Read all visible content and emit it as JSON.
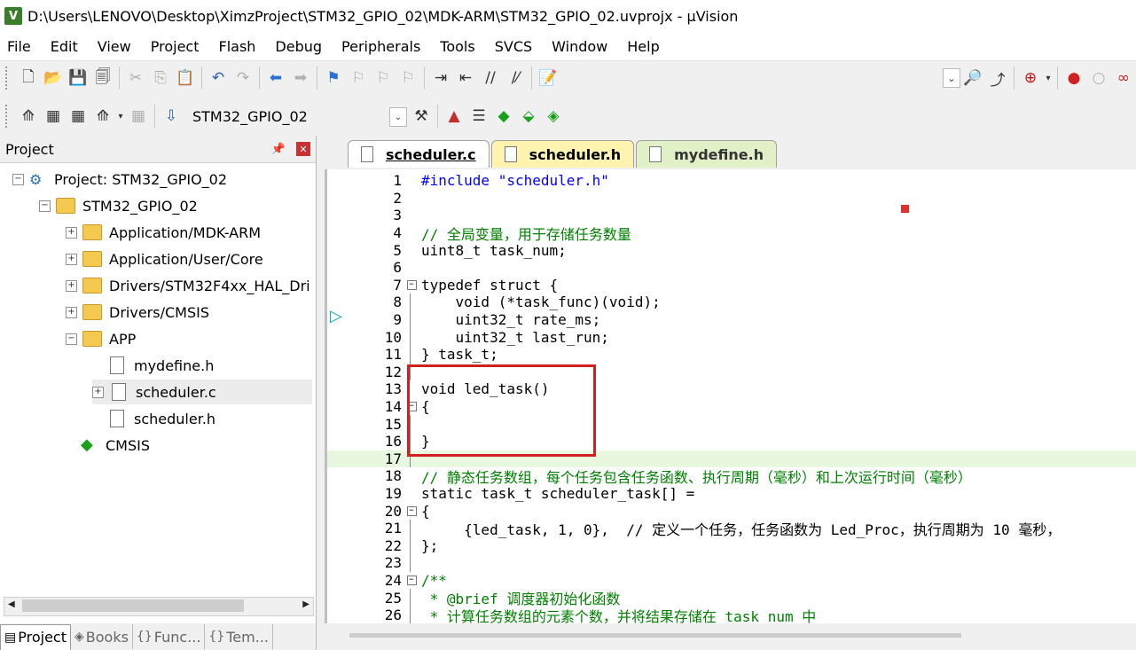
{
  "window": {
    "title": "D:\\Users\\LENOVO\\Desktop\\XimzProject\\STM32_GPIO_02\\MDK-ARM\\STM32_GPIO_02.uvprojx - µVision",
    "app_icon": "V"
  },
  "menu": [
    "File",
    "Edit",
    "View",
    "Project",
    "Flash",
    "Debug",
    "Peripherals",
    "Tools",
    "SVCS",
    "Window",
    "Help"
  ],
  "toolbar2": {
    "target": "STM32_GPIO_02"
  },
  "project_panel": {
    "title": "Project",
    "tree": [
      {
        "label": "Project: STM32_GPIO_02"
      },
      {
        "label": "STM32_GPIO_02"
      },
      {
        "label": "Application/MDK-ARM"
      },
      {
        "label": "Application/User/Core"
      },
      {
        "label": "Drivers/STM32F4xx_HAL_Dri"
      },
      {
        "label": "Drivers/CMSIS"
      },
      {
        "label": "APP"
      },
      {
        "label": "mydefine.h"
      },
      {
        "label": "scheduler.c"
      },
      {
        "label": "scheduler.h"
      },
      {
        "label": "CMSIS"
      }
    ],
    "bottom_tabs": [
      {
        "label": "Project"
      },
      {
        "label": "Books"
      },
      {
        "label": "Func..."
      },
      {
        "label": "Tem..."
      }
    ]
  },
  "editor": {
    "tabs": [
      {
        "label": "scheduler.c"
      },
      {
        "label": "scheduler.h"
      },
      {
        "label": "mydefine.h"
      }
    ],
    "lines": [
      {
        "n": "1",
        "t": "#include \"scheduler.h\""
      },
      {
        "n": "2",
        "t": ""
      },
      {
        "n": "3",
        "t": ""
      },
      {
        "n": "4",
        "t": "// 全局变量，用于存储任务数量"
      },
      {
        "n": "5",
        "t": "uint8_t task_num;"
      },
      {
        "n": "6",
        "t": ""
      },
      {
        "n": "7",
        "t": "typedef struct {"
      },
      {
        "n": "8",
        "t": "    void (*task_func)(void);"
      },
      {
        "n": "9",
        "t": "    uint32_t rate_ms;"
      },
      {
        "n": "10",
        "t": "    uint32_t last_run;"
      },
      {
        "n": "11",
        "t": "} task_t;"
      },
      {
        "n": "12",
        "t": ""
      },
      {
        "n": "13",
        "t": "void led_task()"
      },
      {
        "n": "14",
        "t": "{"
      },
      {
        "n": "15",
        "t": ""
      },
      {
        "n": "16",
        "t": "}"
      },
      {
        "n": "17",
        "t": ""
      },
      {
        "n": "18",
        "t": "// 静态任务数组，每个任务包含任务函数、执行周期（毫秒）和上次运行时间（毫秒）"
      },
      {
        "n": "19",
        "t": "static task_t scheduler_task[] ="
      },
      {
        "n": "20",
        "t": "{"
      },
      {
        "n": "21",
        "t": "     {led_task, 1, 0},  // 定义一个任务，任务函数为 Led_Proc，执行周期为 10 毫秒，"
      },
      {
        "n": "22",
        "t": "};"
      },
      {
        "n": "23",
        "t": ""
      },
      {
        "n": "24",
        "t": "/**"
      },
      {
        "n": "25",
        "t": " * @brief 调度器初始化函数"
      },
      {
        "n": "26",
        "t": " * 计算任务数组的元素个数，并将结果存储在 task_num 中"
      }
    ]
  }
}
